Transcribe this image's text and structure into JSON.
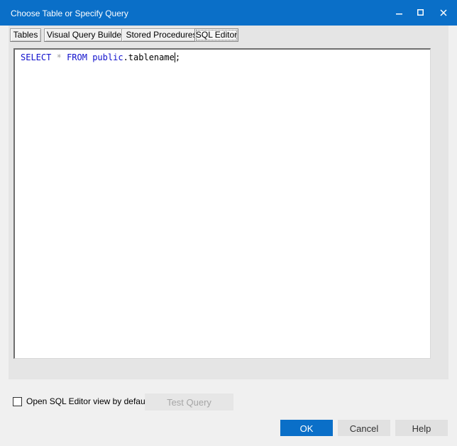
{
  "window": {
    "title": "Choose Table or Specify Query",
    "controls": {
      "minimize_icon": "minimize-icon",
      "maximize_icon": "maximize-icon",
      "close_icon": "close-icon"
    }
  },
  "tabs": [
    {
      "label": "Tables"
    },
    {
      "label": "Visual Query Builder"
    },
    {
      "label": "Stored Procedures"
    },
    {
      "label": "SQL Editor",
      "active": true
    }
  ],
  "editor": {
    "tokens": {
      "select": "SELECT",
      "star": "*",
      "from": "FROM",
      "schema": "public",
      "dot": ".",
      "table": "tablename",
      "semicolon": ";"
    }
  },
  "footer": {
    "checkbox_label": "Open SQL Editor view by default",
    "checkbox_checked": false,
    "test_query_label": "Test Query"
  },
  "buttons": {
    "ok": "OK",
    "cancel": "Cancel",
    "help": "Help"
  },
  "colors": {
    "accent": "#0a6fc8",
    "keyword": "#1010cc"
  }
}
